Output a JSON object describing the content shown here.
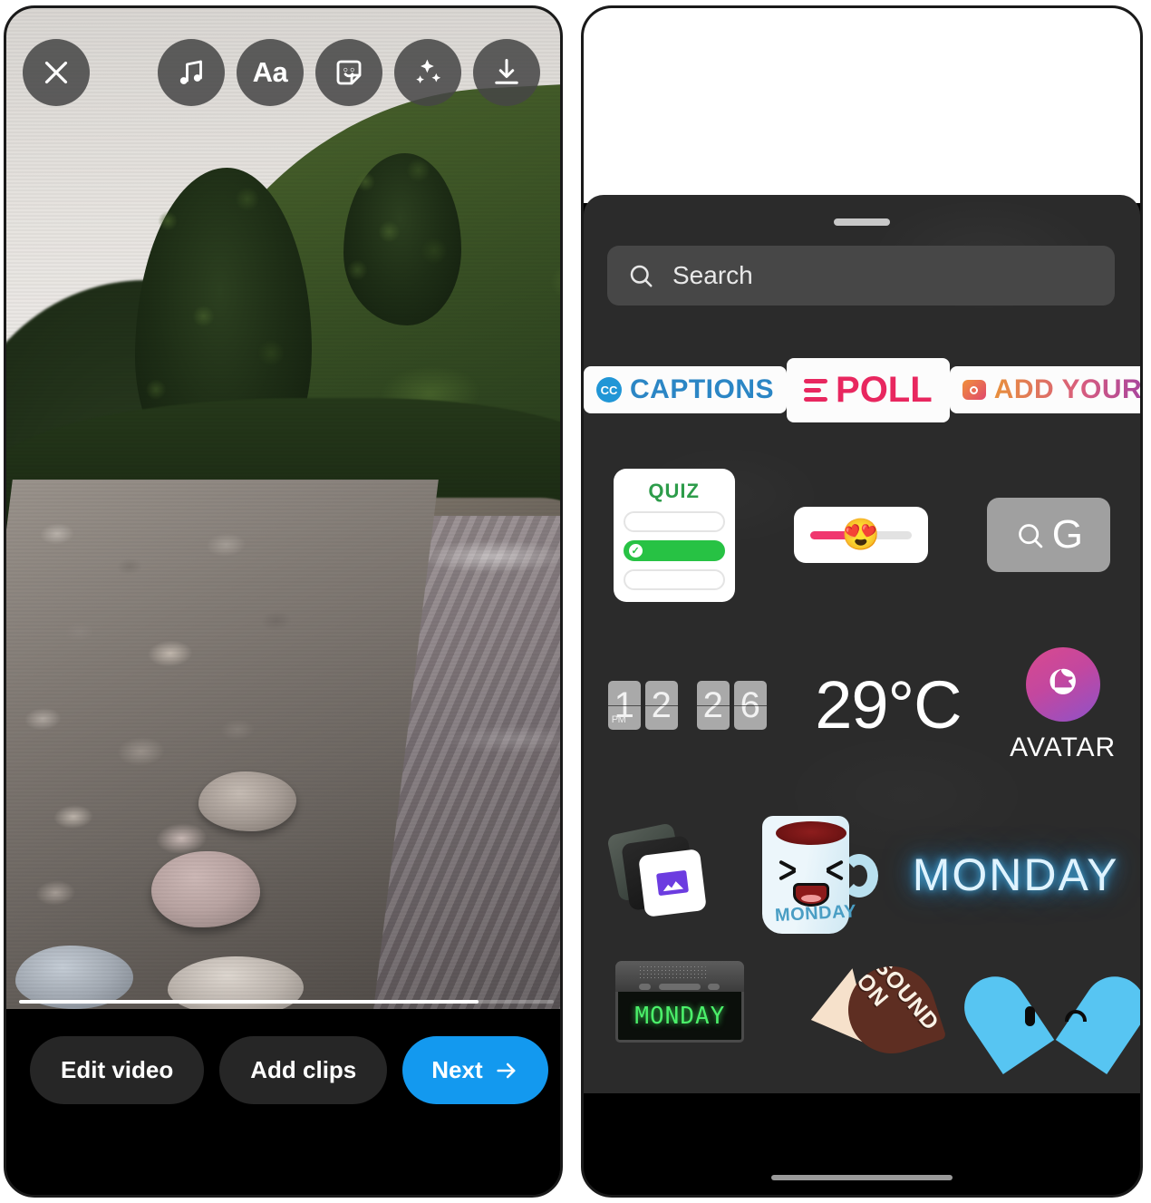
{
  "left_phone": {
    "name": "story-video-editor",
    "toolbar": {
      "close_label": "×",
      "items": [
        {
          "name": "close-icon",
          "label": "Close"
        },
        {
          "name": "music-icon",
          "label": "Music"
        },
        {
          "name": "text-icon",
          "label": "Aa"
        },
        {
          "name": "sticker-icon",
          "label": "Stickers"
        },
        {
          "name": "effects-icon",
          "label": "Effects"
        },
        {
          "name": "download-icon",
          "label": "Save"
        }
      ]
    },
    "media": {
      "type": "video",
      "description": "River flowing through a green valley with rocky shore",
      "progress_percent": 86
    },
    "actions": {
      "edit_video": "Edit video",
      "add_clips": "Add clips",
      "next": "Next"
    },
    "accent_color": "#1399ef"
  },
  "right_phone": {
    "name": "sticker-tray",
    "search": {
      "placeholder": "Search",
      "value": "",
      "icon": "search-icon"
    },
    "rows": [
      {
        "name": "badge-row",
        "items": [
          {
            "name": "captions-sticker",
            "label": "CAPTIONS",
            "icon": "cc-icon",
            "color": "#2b86c5"
          },
          {
            "name": "poll-sticker",
            "label": "POLL",
            "icon": "poll-lines-icon",
            "color": "#e8275f"
          },
          {
            "name": "add-yours-sticker",
            "label": "ADD YOURS",
            "icon": "camera-icon",
            "color": "#d85c7e"
          }
        ]
      },
      {
        "name": "interactive-row",
        "quiz": {
          "name": "quiz-sticker",
          "title": "QUIZ",
          "options": 3,
          "correct_index": 1,
          "correct_color": "#27c244"
        },
        "slider": {
          "name": "emoji-slider-sticker",
          "emoji": "😍",
          "fill_percent": 42,
          "track_color": "#f0366e"
        },
        "gif": {
          "name": "gif-search-button",
          "label": "G",
          "icon": "search-icon"
        }
      },
      {
        "name": "info-row",
        "clock": {
          "name": "flip-clock-sticker",
          "hour": "12",
          "minute": "26",
          "meridiem": "PM"
        },
        "temperature": {
          "name": "temperature-sticker",
          "label": "29°C"
        },
        "avatar": {
          "name": "avatar-sticker",
          "label": "AVATAR"
        }
      },
      {
        "name": "gif-row-1",
        "items": [
          {
            "name": "photo-stack-sticker",
            "label": ""
          },
          {
            "name": "monday-mug-sticker",
            "label": "MONDAY"
          },
          {
            "name": "neon-monday-sticker",
            "label": "MONDAY"
          }
        ]
      },
      {
        "name": "gif-row-2",
        "items": [
          {
            "name": "alarm-clock-sticker",
            "label": "MONDAY"
          },
          {
            "name": "sound-on-sticker",
            "label": "SOUND ON"
          },
          {
            "name": "blue-heart-sticker",
            "label": ""
          }
        ]
      }
    ],
    "tray_background": "#2b2b2b",
    "search_background": "#474747"
  }
}
